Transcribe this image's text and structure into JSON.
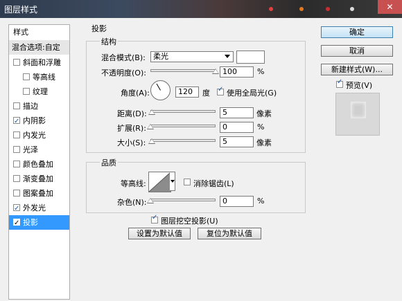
{
  "window": {
    "title": "图层样式",
    "close": "✕"
  },
  "styles_panel": {
    "header": "样式",
    "blend_options": "混合选项:自定",
    "items": [
      {
        "label": "斜面和浮雕",
        "checked": false,
        "indent": false
      },
      {
        "label": "等高线",
        "checked": false,
        "indent": true
      },
      {
        "label": "纹理",
        "checked": false,
        "indent": true
      },
      {
        "label": "描边",
        "checked": false,
        "indent": false
      },
      {
        "label": "内阴影",
        "checked": true,
        "indent": false
      },
      {
        "label": "内发光",
        "checked": false,
        "indent": false
      },
      {
        "label": "光泽",
        "checked": false,
        "indent": false
      },
      {
        "label": "颜色叠加",
        "checked": false,
        "indent": false
      },
      {
        "label": "渐变叠加",
        "checked": false,
        "indent": false
      },
      {
        "label": "图案叠加",
        "checked": false,
        "indent": false
      },
      {
        "label": "外发光",
        "checked": true,
        "indent": false
      },
      {
        "label": "投影",
        "checked": true,
        "indent": false,
        "selected": true
      }
    ]
  },
  "drop_shadow": {
    "section_title": "投影",
    "structure": {
      "title": "结构",
      "blend_mode_label": "混合模式(B):",
      "blend_mode_value": "柔光",
      "color": "#ffffff",
      "opacity_label": "不透明度(O):",
      "opacity_value": "100",
      "opacity_unit": "%",
      "opacity_fraction": 1.0,
      "angle_label": "角度(A):",
      "angle_value": "120",
      "angle_unit": "度",
      "global_light_label": "使用全局光(G)",
      "global_light_checked": true,
      "distance_label": "距离(D):",
      "distance_value": "5",
      "distance_unit": "像素",
      "distance_fraction": 0.02,
      "spread_label": "扩展(R):",
      "spread_value": "0",
      "spread_unit": "%",
      "spread_fraction": 0.0,
      "size_label": "大小(S):",
      "size_value": "5",
      "size_unit": "像素",
      "size_fraction": 0.02
    },
    "quality": {
      "title": "品质",
      "contour_label": "等高线:",
      "anti_alias_label": "消除锯齿(L)",
      "anti_alias_checked": false,
      "noise_label": "杂色(N):",
      "noise_value": "0",
      "noise_unit": "%",
      "noise_fraction": 0.0
    },
    "knockout_label": "图层挖空投影(U)",
    "knockout_checked": true,
    "make_default": "设置为默认值",
    "reset_default": "复位为默认值"
  },
  "actions": {
    "ok": "确定",
    "cancel": "取消",
    "new_style": "新建样式(W)...",
    "preview_label": "预览(V)",
    "preview_checked": true
  }
}
